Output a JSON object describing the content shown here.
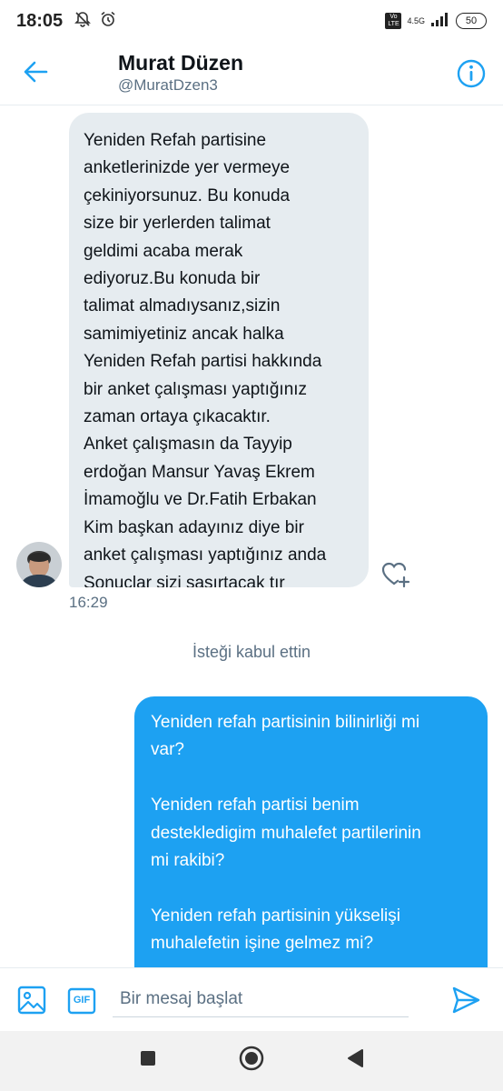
{
  "status_bar": {
    "time": "18:05",
    "volte_label": "Vo LTE",
    "network_label": "4.5G",
    "battery": "50"
  },
  "header": {
    "name": "Murat Düzen",
    "handle": "@MuratDzen3"
  },
  "conversation": {
    "incoming": {
      "text": "Yeniden Refah partisine\nanketlerinizde yer vermeye\nçekiniyorsunuz. Bu konuda\nsize bir yerlerden talimat\ngeldimi acaba merak\nediyoruz.Bu konuda bir\ntalimat almadıysanız,sizin\nsamimiyetiniz ancak halka\nYeniden Refah partisi hakkında\nbir anket çalışması yaptığınız\nzaman ortaya çıkacaktır.\nAnket çalışmasın da Tayyip\nerdoğan Mansur Yavaş Ekrem\nİmamoğlu ve Dr.Fatih Erbakan\nKim başkan adayınız diye bir\nanket çalışması yaptığınız anda\nSonuçlar sizi şaşırtacak tır\numarım.",
      "time": "16:29"
    },
    "system_note": "İsteği kabul ettin",
    "outgoing": {
      "text": "Yeniden refah partisinin bilinirliği mi\nvar?\n\nYeniden refah partisi benim\ndestekledigim muhalefet partilerinin\nmi rakibi?\n\nYeniden refah partisinin yükselişi\nmuhalefetin işine gelmez mi?\n\nSiz bir ülkeyi AKP'den kurtarmak mı"
    }
  },
  "composer": {
    "placeholder": "Bir mesaj başlat",
    "gif_label": "GIF"
  },
  "icons": {
    "back": "arrow-left-icon",
    "info": "info-icon",
    "like": "heart-plus-icon",
    "media": "image-icon",
    "gif": "gif-icon",
    "send": "send-icon"
  },
  "colors": {
    "accent": "#1da1f2",
    "incoming_bubble": "#e6ecf0",
    "secondary_text": "#5b7083"
  }
}
